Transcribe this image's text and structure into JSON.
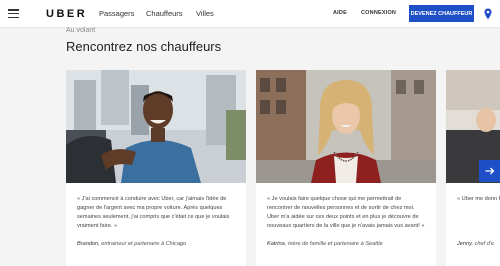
{
  "nav": {
    "logo": "UBER",
    "links": [
      "Passagers",
      "Chauffeurs",
      "Villes"
    ],
    "help": "AIDE",
    "login": "CONNEXION",
    "cta": "DEVENEZ CHAUFFEUR"
  },
  "section": {
    "eyebrow": "Au volant",
    "title": "Rencontrez nos chauffeurs"
  },
  "cards": [
    {
      "quote": "« J'ai commencé à conduire avec Uber, car j'aimais l'idée de gagner de l'argent avec ma propre voiture. Après quelques semaines seulement, j'ai compris que c'était ce que je voulais vraiment faire. »",
      "name": "Brandon",
      "role": ", entraineur et partenaire à Chicago"
    },
    {
      "quote": "« Je voulais faire quelque chose qui me permettrait de rencontrer de nouvelles personnes et de sortir de chez moi. Uber m'a aidée sur ces deux points et en plus je découvre de nouveaux quartiers de la ville que je n'avais jamais vus avant! »",
      "name": "Katrina",
      "role": ", mère de famille et partenaire à Seattle"
    },
    {
      "quote": "« Uber me donn faire mes gâtea gagner de l'arge rêves. »",
      "name": "Jenny",
      "role": ", chef d'e"
    }
  ],
  "colors": {
    "accent": "#1f4fc7",
    "background": "#f4f4f5"
  },
  "icons": [
    "hamburger-menu-icon",
    "location-pin-icon",
    "arrow-right-icon"
  ]
}
